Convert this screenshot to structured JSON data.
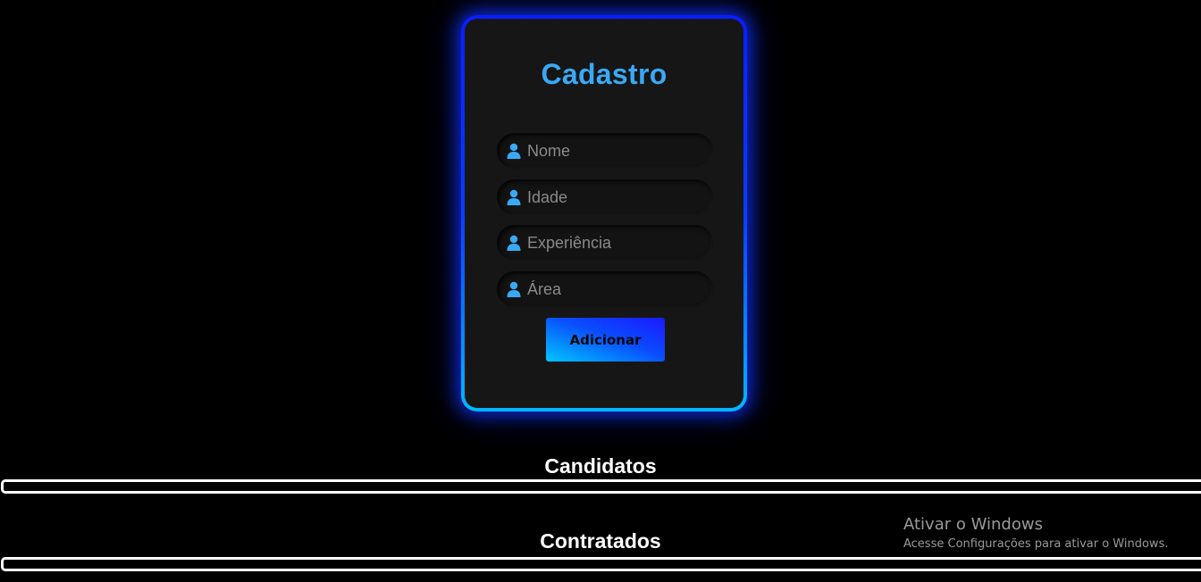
{
  "form": {
    "title": "Cadastro",
    "fields": [
      {
        "placeholder": "Nome",
        "value": "",
        "icon": "user-icon"
      },
      {
        "placeholder": "Idade",
        "value": "",
        "icon": "user-icon"
      },
      {
        "placeholder": "Experiência",
        "value": "",
        "icon": "user-icon"
      },
      {
        "placeholder": "Área",
        "value": "",
        "icon": "user-icon"
      }
    ],
    "submit_label": "Adicionar"
  },
  "sections": {
    "candidates_title": "Candidatos",
    "hired_title": "Contratados"
  },
  "watermark": {
    "title": "Ativar o Windows",
    "subtitle": "Acesse Configurações para ativar o Windows."
  },
  "colors": {
    "accent": "#3aa9f5",
    "card_border_top": "#0a1dff",
    "card_border_bottom": "#00b8ff",
    "background": "#000000",
    "card_background": "#161616"
  }
}
